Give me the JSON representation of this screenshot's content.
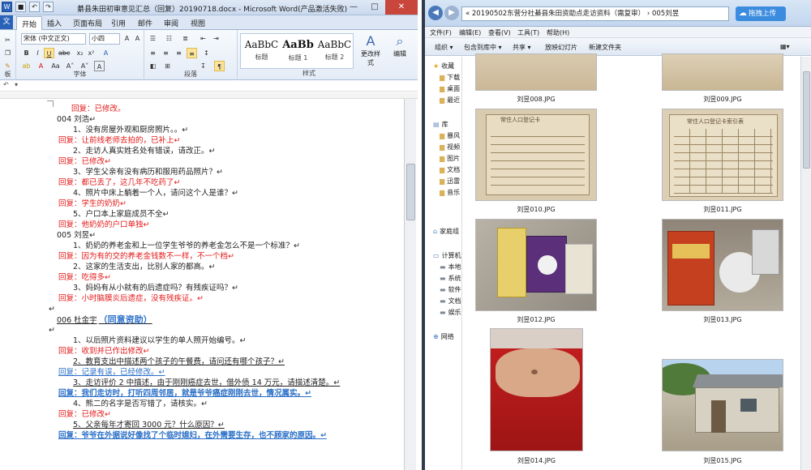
{
  "word": {
    "title": "綦县朱田初审意见汇总（回复）20190718.docx - Microsoft Word(产品激活失败)",
    "tabs": {
      "file": "文",
      "start": "开始",
      "insert": "插入",
      "layout": "页面布局",
      "ref": "引用",
      "mail": "邮件",
      "review": "审阅",
      "view": "视图"
    },
    "font_name": "宋体 (中文正文)",
    "font_size": "小四",
    "groups": {
      "font": "字体",
      "para": "段落",
      "styles": "样式",
      "edit": "编辑"
    },
    "styles": [
      {
        "preview": "AaBbC",
        "name": "标题"
      },
      {
        "preview": "AaBb",
        "name": "标题 1"
      },
      {
        "preview": "AaBbC",
        "name": "标题 2"
      }
    ],
    "change_styles": "更改样式",
    "edit_btn": "编辑",
    "doc_lines": [
      {
        "text": "回复：已修改。",
        "cls": "red"
      },
      {
        "text": "004 刘浩↵",
        "cls": ""
      },
      {
        "text": "1、没有房屋外观和厨房照片。。↵",
        "cls": ""
      },
      {
        "text": "回复：让前线老师去拍的，已补上↵",
        "cls": "red"
      },
      {
        "text": "2、走访人真实姓名处有错误，请改正。↵",
        "cls": ""
      },
      {
        "text": "回复：已修改↵",
        "cls": "red"
      },
      {
        "text": "3、学生父亲有没有病历和服用药品照片？↵",
        "cls": ""
      },
      {
        "text": "回复：都已丢了，这几年不吃药了↵",
        "cls": "red"
      },
      {
        "text": "4、照片中床上躺着一个人，请问这个人是谁？↵",
        "cls": ""
      },
      {
        "text": "回复：学生的奶奶↵",
        "cls": "red"
      },
      {
        "text": "5、户口本上家庭成员不全↵",
        "cls": ""
      },
      {
        "text": "回复：他奶奶的户口单独↵",
        "cls": "red"
      },
      {
        "text": "005 刘昱↵",
        "cls": ""
      },
      {
        "text": "1、奶奶的养老金和上一位学生爷爷的养老金怎么不是一个标准？↵",
        "cls": ""
      },
      {
        "text": "回复：因为有的交的养老金钱数不一样，不一个档↵",
        "cls": "red"
      },
      {
        "text": "2、这家的生活支出，比别人家的都高。↵",
        "cls": ""
      },
      {
        "text": "回复：吃得多↵",
        "cls": "red"
      },
      {
        "text": "3、妈妈有从小就有的后遗症吗？有残疾证吗？↵",
        "cls": ""
      },
      {
        "text": "回复：小时脑膜炎后遗症，没有残疾证。↵",
        "cls": "red"
      },
      {
        "text": "↵",
        "cls": ""
      },
      {
        "text": "006 杜金宇",
        "cls": "ul",
        "suffix": "（同意资助）"
      },
      {
        "text": "↵",
        "cls": ""
      },
      {
        "text": "1、以后照片资料建议以学生的单人照开始编号。↵",
        "cls": ""
      },
      {
        "text": "回复：收到并已作出修改↵",
        "cls": "red"
      },
      {
        "text": "2、教育支出中描述两个孩子的午餐费，请问还有哪个孩子？↵",
        "cls": "ul"
      },
      {
        "text": "回复：记录有误，已经修改。↵",
        "cls": "blue ul"
      },
      {
        "text": "3、走访评价 2 中描述，由于刚刚癌症去世，借外债 14 万元，请描述清楚。↵",
        "cls": "ul"
      },
      {
        "text": "回复：我们走访时，打听四周邻居，就是爷爷癌症刚刚去世，情况属实。↵",
        "cls": "blue ul bold"
      },
      {
        "text": "4、熊二的名字是否写错了，请核实。↵",
        "cls": ""
      },
      {
        "text": "回复：已修改↵",
        "cls": "red"
      },
      {
        "text": "5、父亲每年才寄回 3000 元？什么原因？↵",
        "cls": "ul"
      },
      {
        "text": "回复：爷爷在外据说好像找了个临时媳妇，在外需要生存，也不顾家的原因。↵",
        "cls": "blue ul bold"
      }
    ]
  },
  "explorer": {
    "address": "«  20190502东营分社綦县朱田资助点走访资料（需复审）  ›  005刘昱",
    "upload": "拖拽上传",
    "menu": [
      "文件(F)",
      "编辑(E)",
      "查看(V)",
      "工具(T)",
      "帮助(H)"
    ],
    "toolbar": [
      "组织 ▾",
      "包含到库中 ▾",
      "共享 ▾",
      "放映幻灯片",
      "新建文件夹"
    ],
    "nav": [
      {
        "label": "收藏",
        "type": "star"
      },
      {
        "label": "下载",
        "type": "folder"
      },
      {
        "label": "桌面",
        "type": "folder"
      },
      {
        "label": "最近",
        "type": "folder"
      },
      {
        "label": "库",
        "type": "lib"
      },
      {
        "label": "暴风",
        "type": "folder"
      },
      {
        "label": "视频",
        "type": "folder"
      },
      {
        "label": "图片",
        "type": "folder"
      },
      {
        "label": "文档",
        "type": "folder"
      },
      {
        "label": "迅雷",
        "type": "folder"
      },
      {
        "label": "音乐",
        "type": "folder"
      },
      {
        "label": "家庭组",
        "type": "home"
      },
      {
        "label": "计算机",
        "type": "pc"
      },
      {
        "label": "本地",
        "type": "disk"
      },
      {
        "label": "系统",
        "type": "disk"
      },
      {
        "label": "软件",
        "type": "disk"
      },
      {
        "label": "文档",
        "type": "disk"
      },
      {
        "label": "娱乐",
        "type": "disk"
      },
      {
        "label": "网络",
        "type": "net"
      }
    ],
    "files": [
      "刘昱008.JPG",
      "刘昱009.JPG",
      "刘昱010.JPG",
      "刘昱011.JPG",
      "刘昱012.JPG",
      "刘昱013.JPG",
      "刘昱014.JPG",
      "刘昱015.JPG"
    ],
    "doc_headers": [
      "常住人口登记卡",
      "常住人口登记卡索引表"
    ]
  }
}
